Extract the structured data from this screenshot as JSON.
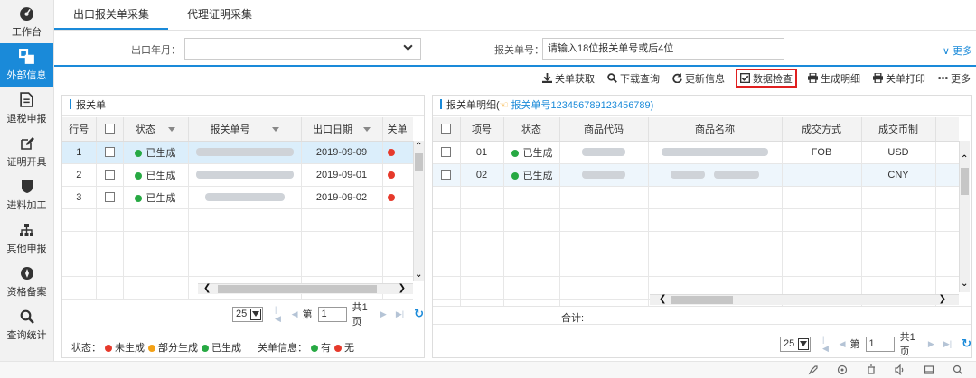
{
  "sidebar": {
    "items": [
      {
        "label": "工作台",
        "icon": "dashboard-icon",
        "active": false
      },
      {
        "label": "外部信息",
        "icon": "external-info-icon",
        "active": true
      },
      {
        "label": "退税申报",
        "icon": "document-icon",
        "active": false
      },
      {
        "label": "证明开具",
        "icon": "edit-icon",
        "active": false
      },
      {
        "label": "进料加工",
        "icon": "shield-icon",
        "active": false
      },
      {
        "label": "其他申报",
        "icon": "org-chart-icon",
        "active": false
      },
      {
        "label": "资格备案",
        "icon": "compass-icon",
        "active": false
      },
      {
        "label": "查询统计",
        "icon": "search-icon",
        "active": false
      }
    ]
  },
  "tabs": [
    {
      "label": "出口报关单采集",
      "active": true
    },
    {
      "label": "代理证明采集",
      "active": false
    }
  ],
  "filter": {
    "month_label": "出口年月：",
    "month_value": "",
    "decl_label": "报关单号：",
    "decl_placeholder": "请输入18位报关单号或后4位",
    "more_label": "更多"
  },
  "toolbar": {
    "buttons": [
      {
        "label": "关单获取",
        "icon": "download-icon"
      },
      {
        "label": "下载查询",
        "icon": "search-icon"
      },
      {
        "label": "更新信息",
        "icon": "refresh-icon"
      },
      {
        "label": "数据检查",
        "icon": "checkbox-icon",
        "highlighted": true
      },
      {
        "label": "生成明细",
        "icon": "print-icon"
      },
      {
        "label": "关单打印",
        "icon": "print-icon"
      },
      {
        "label": "更多",
        "icon": "ellipsis-icon"
      }
    ]
  },
  "left_panel": {
    "title": "报关单",
    "columns": [
      "行号",
      "",
      "状态",
      "报关单号",
      "出口日期",
      "关单"
    ],
    "rows": [
      {
        "row_no": "1",
        "status": "已生成",
        "date": "2019-09-09",
        "selected": true
      },
      {
        "row_no": "2",
        "status": "已生成",
        "date": "2019-09-01",
        "selected": false
      },
      {
        "row_no": "3",
        "status": "已生成",
        "date": "2019-09-02",
        "selected": false
      }
    ],
    "pager": {
      "page_size": "25",
      "page_prefix": "第",
      "page_value": "1",
      "total": "共1页"
    },
    "legend": {
      "status_label": "状态：",
      "s1": "未生成",
      "s2": "部分生成",
      "s3": "已生成",
      "info_label": "关单信息：",
      "i1": "有",
      "i2": "无"
    }
  },
  "right_panel": {
    "title": "报关单明细",
    "subtitle_open": "(",
    "subtitle_link": "报关单号123456789123456789",
    "subtitle_close": ")",
    "columns": [
      "",
      "项号",
      "状态",
      "商品代码",
      "商品名称",
      "成交方式",
      "成交币制"
    ],
    "rows": [
      {
        "item_no": "01",
        "status": "已生成",
        "deal_mode": "FOB",
        "currency": "USD",
        "selected": true
      },
      {
        "item_no": "02",
        "status": "已生成",
        "deal_mode": "",
        "currency": "CNY",
        "selected": false
      }
    ],
    "total_label": "合计:",
    "pager": {
      "page_size": "25",
      "page_prefix": "第",
      "page_value": "1",
      "total": "共1页"
    }
  },
  "colors": {
    "accent": "#1a8ad9",
    "success": "#27a943",
    "danger": "#e6392b",
    "warning": "#f3a116",
    "highlight_border": "#e02020"
  }
}
